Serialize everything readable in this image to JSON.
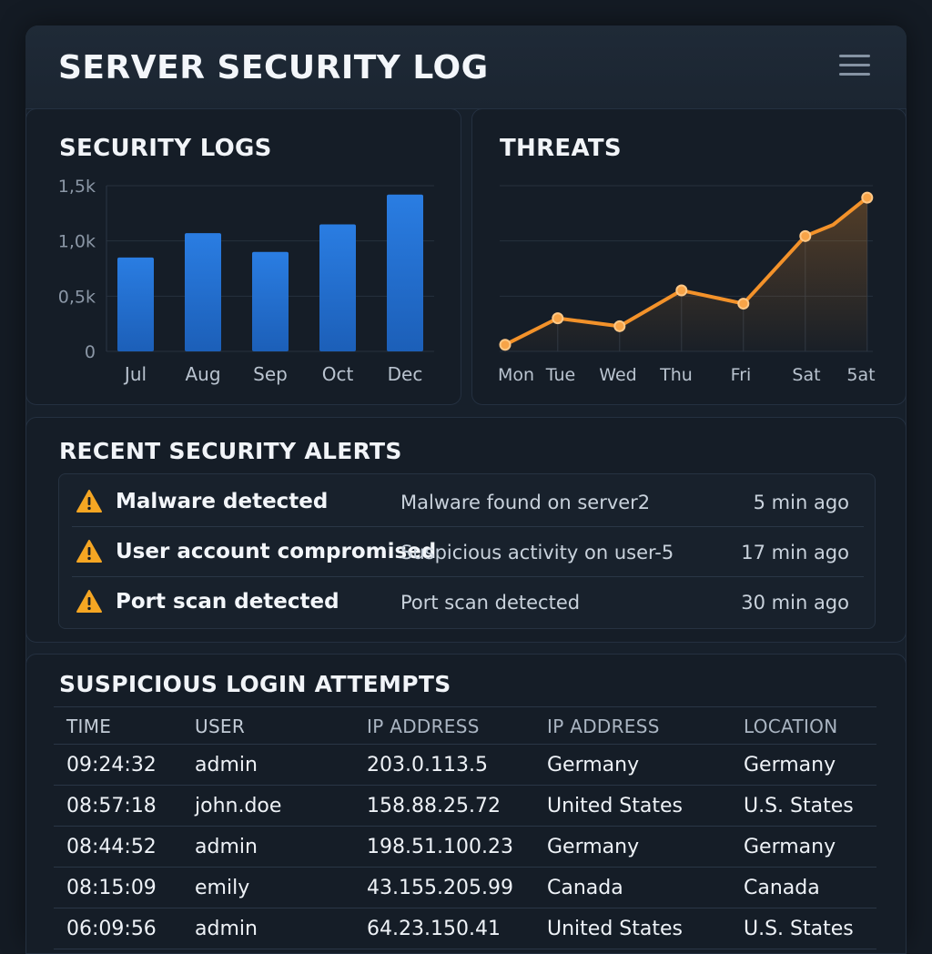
{
  "header": {
    "title": "SERVER SECURITY LOG",
    "menu_icon": "hamburger-menu-icon"
  },
  "colors": {
    "background": "#141b24",
    "panel": "#151d27",
    "bar_blue": "#2172d6",
    "threat_orange": "#f3922a",
    "alert_yellow": "#f5a623"
  },
  "security_logs": {
    "title": "SECURITY LOGS",
    "chart_data": {
      "type": "bar",
      "categories": [
        "Jul",
        "Aug",
        "Sep",
        "Oct",
        "Dec"
      ],
      "values": [
        850,
        1070,
        900,
        1150,
        1420
      ],
      "ytick_labels": [
        "1,5k",
        "1,0k",
        "0,5k",
        "0"
      ],
      "ylim": [
        0,
        1500
      ],
      "grid": true,
      "color": "#2172d6"
    }
  },
  "threats": {
    "title": "THREATS",
    "chart_data": {
      "type": "area",
      "x": [
        "Mon",
        "Tue",
        "Wed",
        "Thu",
        "Fri",
        "Sat",
        "5at"
      ],
      "points": [
        {
          "x": 0,
          "y": 1
        },
        {
          "x": 0.85,
          "y": 5
        },
        {
          "x": 1.85,
          "y": 3.8
        },
        {
          "x": 2.85,
          "y": 9.2
        },
        {
          "x": 3.85,
          "y": 7.2
        },
        {
          "x": 4.85,
          "y": 17.4
        },
        {
          "x": 5.3,
          "y": 19.1
        },
        {
          "x": 5.85,
          "y": 23.2
        }
      ],
      "marker_indices": [
        0,
        1,
        2,
        3,
        4,
        5,
        7
      ],
      "ylim": [
        0,
        25
      ],
      "grid": true,
      "color": "#f3922a"
    }
  },
  "alerts": {
    "title": "RECENT SECURITY ALERTS",
    "icon": "warning-triangle-icon",
    "items": [
      {
        "name": "Malware detected",
        "description": "Malware found on server2",
        "time": "5 min ago"
      },
      {
        "name": "User account compromised",
        "description": "Suspicious activity on user-5",
        "time": "17 min ago"
      },
      {
        "name": "Port scan detected",
        "description": "Port scan detected",
        "time": "30 min ago"
      }
    ]
  },
  "logins": {
    "title": "SUSPICIOUS LOGIN ATTEMPTS",
    "columns": [
      "TIME",
      "USER",
      "IP ADDRESS",
      "IP ADDRESS",
      "LOCATION"
    ],
    "rows": [
      [
        "09:24:32",
        "admin",
        "203.0.113.5",
        "Germany",
        "Germany"
      ],
      [
        "08:57:18",
        "john.doe",
        "158.88.25.72",
        "United States",
        "U.S. States"
      ],
      [
        "08:44:52",
        "admin",
        "198.51.100.23",
        "Germany",
        "Germany"
      ],
      [
        "08:15:09",
        "emily",
        "43.155.205.99",
        "Canada",
        "Canada"
      ],
      [
        "06:09:56",
        "admin",
        "64.23.150.41",
        "United States",
        "U.S. States"
      ]
    ]
  }
}
